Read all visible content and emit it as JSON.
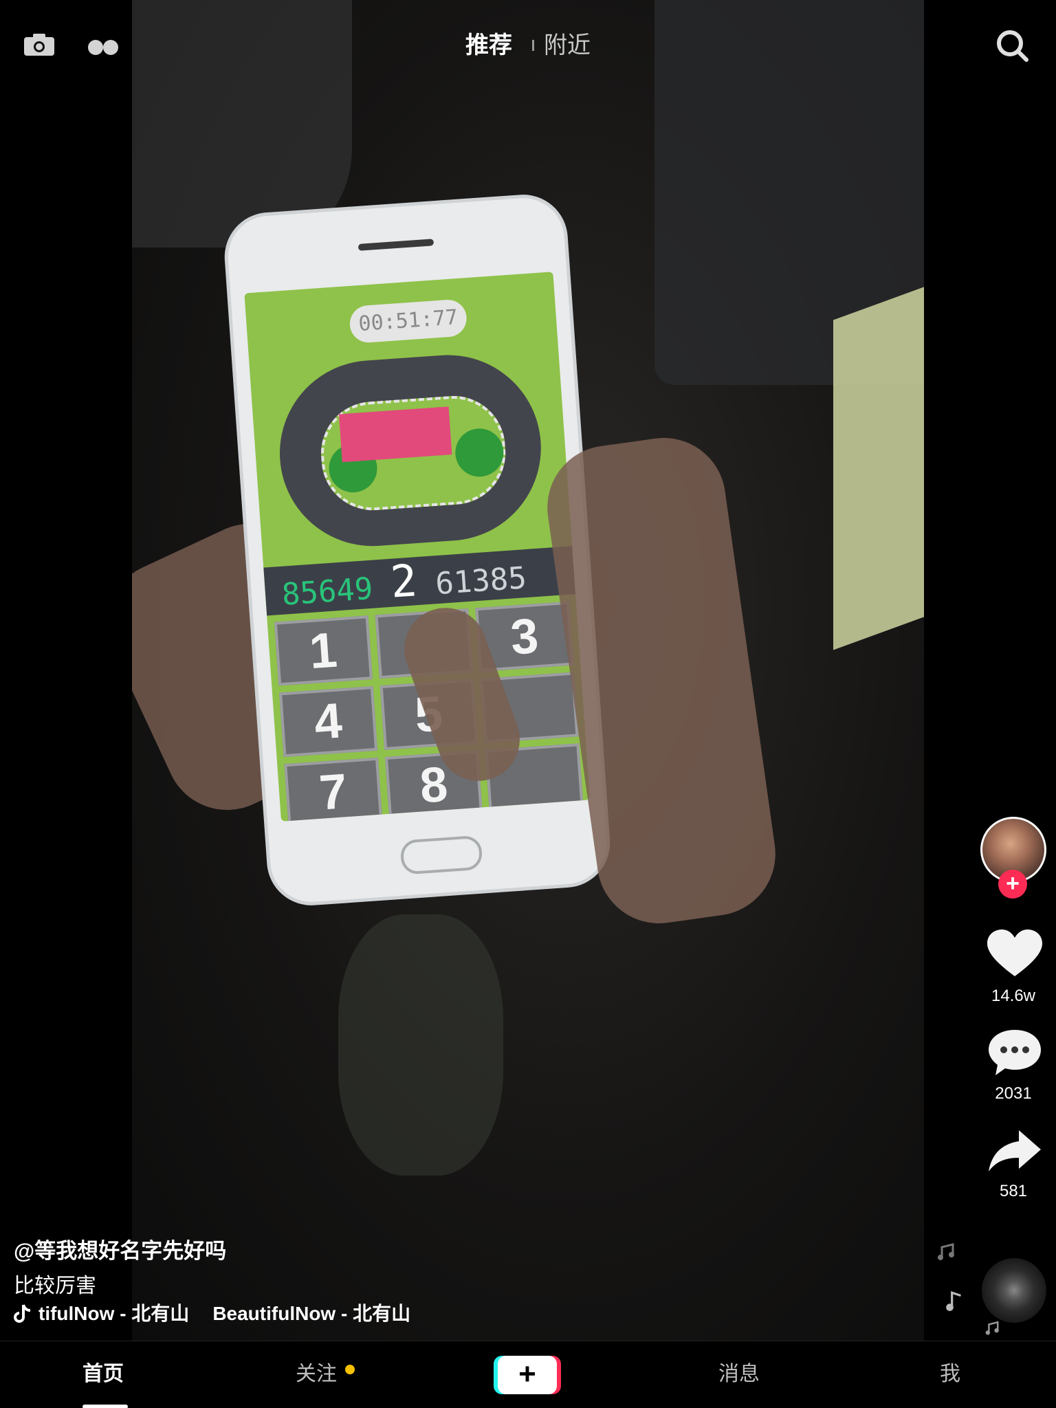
{
  "top_nav": {
    "tabs": [
      {
        "label": "推荐",
        "active": true
      },
      {
        "label": "附近",
        "active": false
      }
    ],
    "icons": [
      "camera-icon",
      "dots-icon",
      "search-icon"
    ]
  },
  "video": {
    "in_video_phone": {
      "timer": "00:51:77",
      "digits_done": "85649",
      "digit_current": "2",
      "digits_todo": "61385",
      "keys": [
        "1",
        "",
        "3",
        "4",
        "5",
        "",
        "7",
        "8",
        ""
      ]
    }
  },
  "actions": {
    "likes": "14.6w",
    "comments": "2031",
    "shares": "581",
    "follow_icon": "plus-icon"
  },
  "caption": {
    "author": "@等我想好名字先好吗",
    "description": "比较厉害",
    "music_1": "tifulNow - 北有山",
    "music_2": "BeautifulNow - 北有山"
  },
  "bottom_tabs": {
    "home": "首页",
    "follow": "关注",
    "create": "+",
    "messages": "消息",
    "me": "我"
  },
  "colors": {
    "accent_pink": "#fe2c55",
    "accent_cyan": "#25f4ee",
    "notification_dot": "#f6c100"
  }
}
